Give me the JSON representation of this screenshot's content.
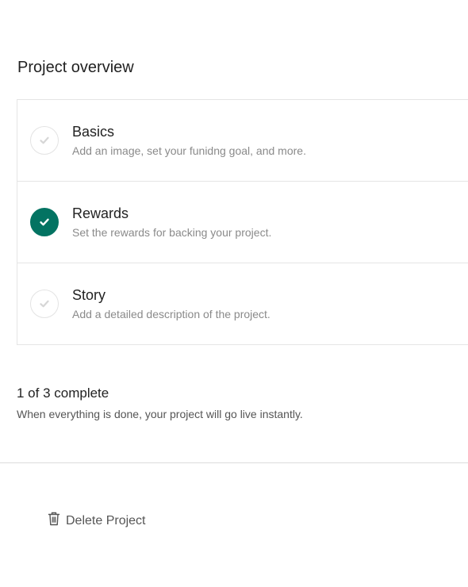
{
  "overview": {
    "title": "Project overview"
  },
  "steps": [
    {
      "name": "Basics",
      "description": "Add an image, set your funidng goal, and more.",
      "complete": false,
      "icon": "check-icon"
    },
    {
      "name": "Rewards",
      "description": "Set the rewards for backing your project.",
      "complete": true,
      "icon": "check-icon"
    },
    {
      "name": "Story",
      "description": "Add a detailed description of the project.",
      "complete": false,
      "icon": "check-icon"
    }
  ],
  "progress": {
    "summary": "1 of 3 complete",
    "note": "When everything is done, your project will go live instantly."
  },
  "actions": {
    "delete_label": "Delete Project",
    "delete_icon": "trash-icon"
  },
  "colors": {
    "complete_accent": "#037362",
    "incomplete_check": "#d6d6d6",
    "border": "#e5e5e5"
  }
}
